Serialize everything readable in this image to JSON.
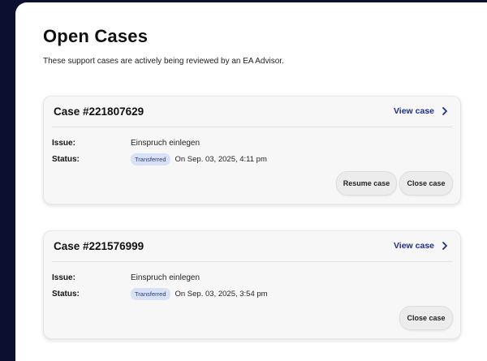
{
  "page": {
    "title": "Open Cases",
    "subtitle": "These support cases are actively being reviewed by an EA Advisor."
  },
  "labels": {
    "issue": "Issue:",
    "status": "Status:",
    "view_case": "View case",
    "resume_case": "Resume case",
    "close_case": "Close case"
  },
  "cases": [
    {
      "title": "Case #221807629",
      "issue": "Einspruch einlegen",
      "status_badge": "Transferred",
      "status_date": "On Sep. 03, 2025, 4:11 pm"
    },
    {
      "title": "Case #221576999",
      "issue": "Einspruch einlegen",
      "status_badge": "Transferred",
      "status_date": "On Sep. 03, 2025, 3:54 pm"
    }
  ],
  "colors": {
    "background": "#0b1030",
    "panel": "#ffffff",
    "link": "#1b2f8f",
    "badge_bg": "#d9e1f7"
  }
}
